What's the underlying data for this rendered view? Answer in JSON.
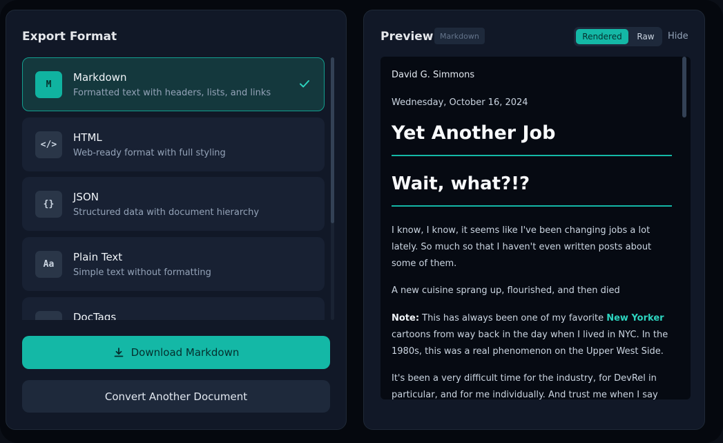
{
  "export_panel": {
    "title": "Export Format",
    "formats": [
      {
        "icon": "M",
        "icon_name": "markdown-icon",
        "name": "Markdown",
        "description": "Formatted text with headers, lists, and links",
        "selected": true
      },
      {
        "icon": "</>",
        "icon_name": "code-icon",
        "name": "HTML",
        "description": "Web-ready format with full styling",
        "selected": false
      },
      {
        "icon": "{}",
        "icon_name": "braces-icon",
        "name": "JSON",
        "description": "Structured data with document hierarchy",
        "selected": false
      },
      {
        "icon": "Aa",
        "icon_name": "text-icon",
        "name": "Plain Text",
        "description": "Simple text without formatting",
        "selected": false
      },
      {
        "icon": "",
        "icon_name": "doctags-icon",
        "name": "DocTags",
        "description": "",
        "selected": false
      }
    ],
    "download_label": "Download Markdown",
    "convert_label": "Convert Another Document"
  },
  "preview_panel": {
    "title": "Preview",
    "badge": "Markdown",
    "toggle": {
      "rendered": "Rendered",
      "raw": "Raw"
    },
    "hide_label": "Hide",
    "document": {
      "author": "David G. Simmons",
      "date": "Wednesday, October 16, 2024",
      "heading1": "Yet Another Job",
      "heading2": "Wait, what?!?",
      "para1": "I know, I know, it seems like I've been changing jobs a lot lately. So much so that I haven't even written posts about some of them.",
      "para2": "A new cuisine sprang up, flourished, and then died",
      "para3_label": "Note:",
      "para3_before": " This has always been one of my favorite ",
      "para3_link": "New Yorker",
      "para3_after": " cartoons from way back in the day when I lived in NYC. In the 1980s, this was a real phenomenon on the Upper West Side.",
      "para4": "It's been a very difficult time for the industry, for DevRel in particular, and for me individually. And trust me when I say that"
    }
  },
  "colors": {
    "accent": "#14b8a6",
    "panel": "#111827",
    "card": "#182133"
  }
}
